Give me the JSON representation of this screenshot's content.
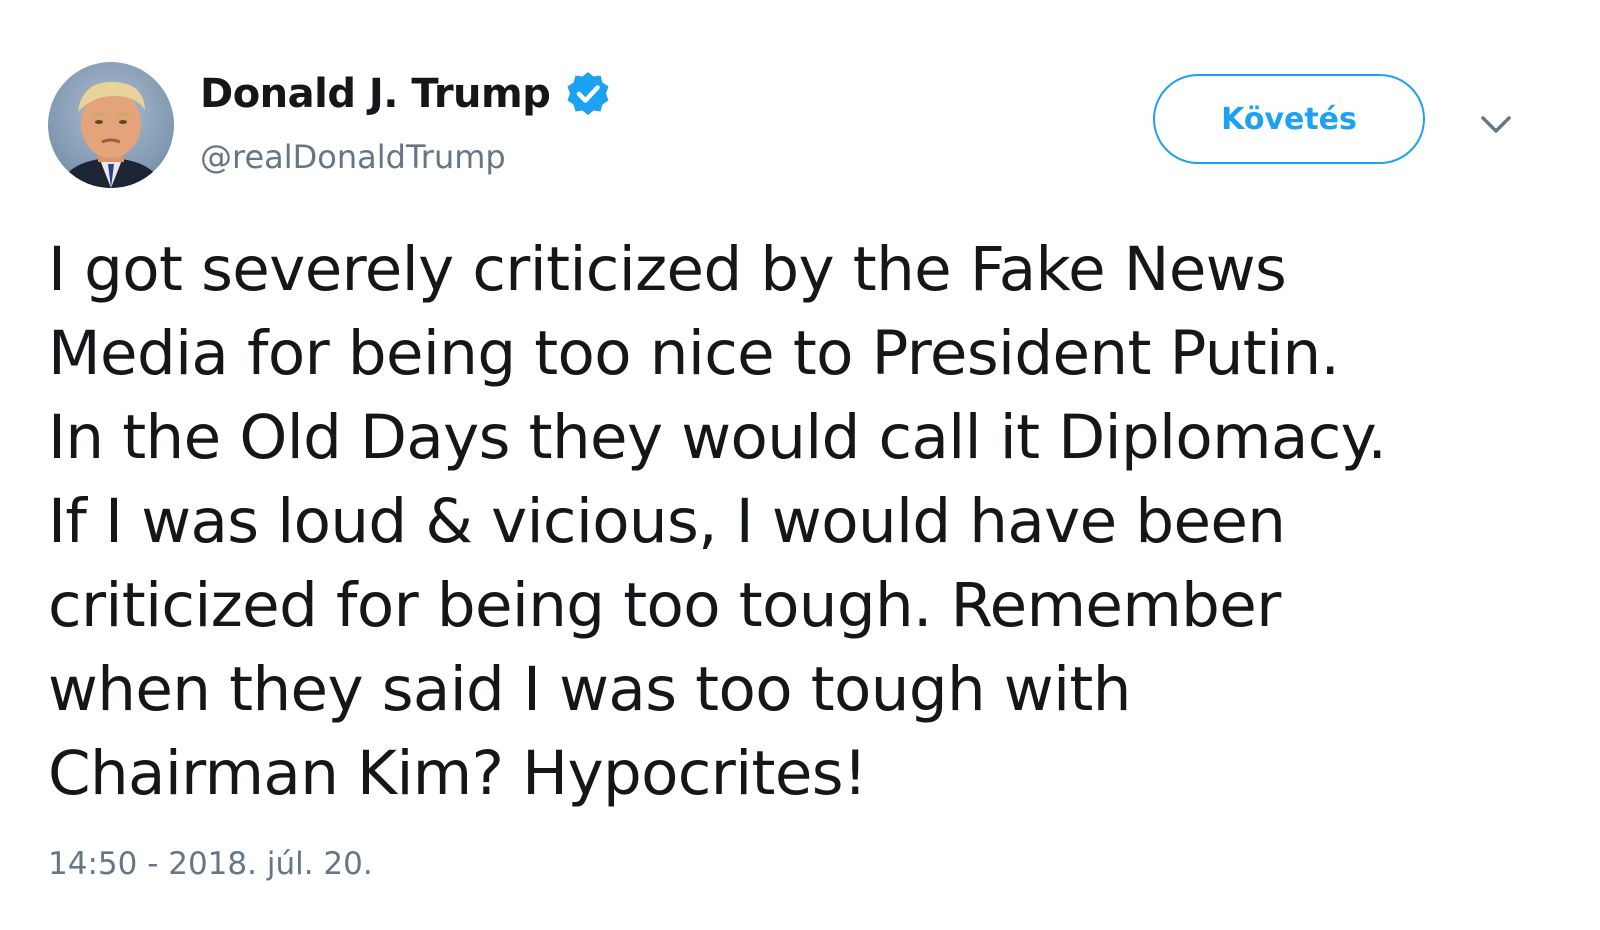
{
  "author": {
    "display_name": "Donald J. Trump",
    "handle": "@realDonaldTrump",
    "verified": true,
    "avatar_icon": "profile-photo"
  },
  "actions": {
    "follow_label": "Követés",
    "menu_icon": "chevron-down-icon"
  },
  "tweet": {
    "lines": [
      "I got severely criticized by the Fake News",
      "Media for being too nice to President Putin.",
      "In the Old Days they would call it Diplomacy.",
      "If I was loud & vicious, I would have been",
      "criticized for being too tough. Remember",
      "when they said I was too tough with",
      "Chairman Kim? Hypocrites!"
    ],
    "timestamp": "14:50 - 2018. júl. 20."
  },
  "colors": {
    "accent": "#1da1f2",
    "text": "#14171a",
    "secondary_text": "#657786"
  }
}
